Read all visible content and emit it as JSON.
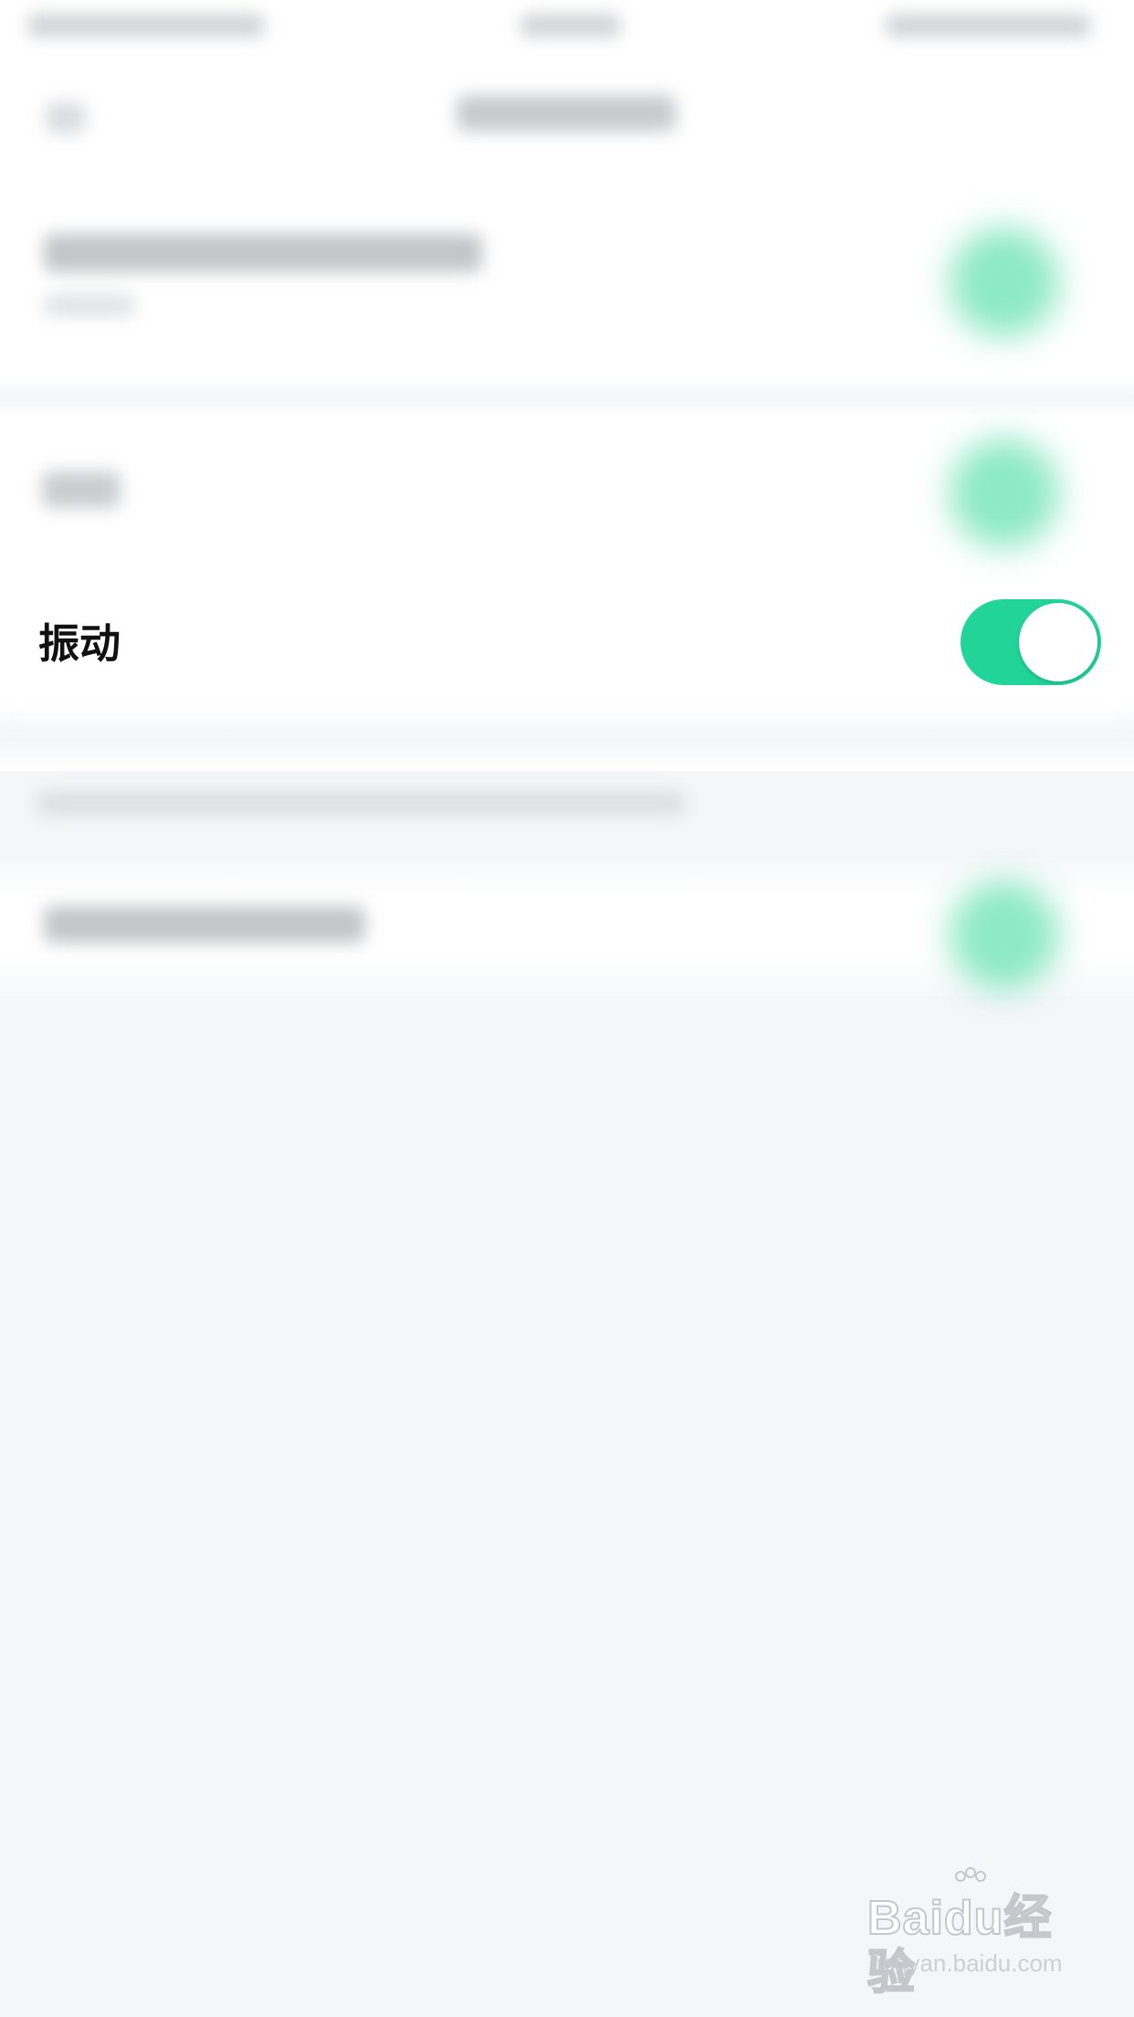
{
  "settings": {
    "vibrate_label": "振动",
    "vibrate_enabled": true
  },
  "colors": {
    "accent": "#22d497",
    "background": "#f5f6f8",
    "row_background": "#ffffff"
  },
  "watermark": {
    "logo_text": "Baidu经验",
    "url_text": "jingyan.baidu.com"
  }
}
